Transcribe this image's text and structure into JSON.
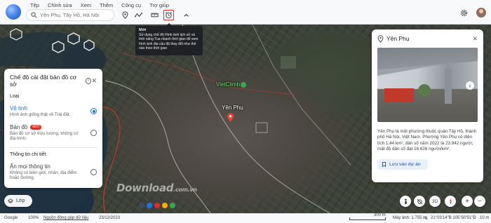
{
  "menu": [
    "Tệp",
    "Chỉnh sửa",
    "Xem",
    "Thêm",
    "Công cụ",
    "Trợ giúp"
  ],
  "search": {
    "placeholder": "Yên Phụ, Tây Hồ, Hà Nội"
  },
  "toolbar": {
    "icons": [
      "search-icon",
      "place-mark-icon",
      "path-icon",
      "ruler-icon",
      "historical-imagery-icon",
      "collapse-icon",
      "settings-icon"
    ]
  },
  "tooltip": {
    "title": "Mới",
    "body": "Sử dụng chế độ Hình ảnh lịch sử và tính năng Tua nhanh thời gian để xem hình ảnh địa cầu đã thay đổi như thế nào theo thời gian"
  },
  "map": {
    "labels": {
      "vietclimb": "VietClimb",
      "yen_phu": "Yên Phụ"
    }
  },
  "base_map_panel": {
    "title": "Chế độ cài đặt bản đồ cơ sở",
    "section_type": "Loại",
    "options": [
      {
        "title": "Vệ tinh",
        "desc": "Hình ảnh giống thật về Trái đất.",
        "selected": true
      },
      {
        "title": "Bản đồ",
        "badge": "MỚI",
        "desc": "Bản đồ cơ sở trừu tượng, không có địa hình.",
        "selected": false
      }
    ],
    "section_details": "Thông tin chi tiết",
    "details_option": {
      "title": "Ẩn mọi thông tin",
      "desc": "Không có biên giới, nhãn, địa điểm hoặc đường.",
      "selected": false
    }
  },
  "place_panel": {
    "title": "Yên Phụ",
    "description": "Yên Phụ là một phường thuộc quận Tây Hồ, thành phố Hà Nội, Việt Nam. Phường Yên Phụ có diện tích 1,44 km², dân số năm 2022 là 23.942 người, mật độ dân số đạt 16.626 người/km².",
    "save_label": "Lưu vào dự án"
  },
  "layer_button": "Lớp",
  "controls": {
    "view_3d": "3D"
  },
  "watermark": {
    "main": "Download",
    "suffix": ".com.vn"
  },
  "color_dots": [
    "#3c4a5a",
    "#1a73e8",
    "#d93025",
    "#f9ab00",
    "#34a853"
  ],
  "status": {
    "brand": "Google",
    "zoom": "100%",
    "contributors": "Nguồn đóng góp dữ liệu",
    "date": "23/12/2023",
    "scale": "300 m",
    "camera": "Máy ảnh: 1.755 m",
    "separator": "⇅",
    "coords": "21°03'14\"B 105°50'51\"Đ",
    "elevation": "10 m"
  }
}
